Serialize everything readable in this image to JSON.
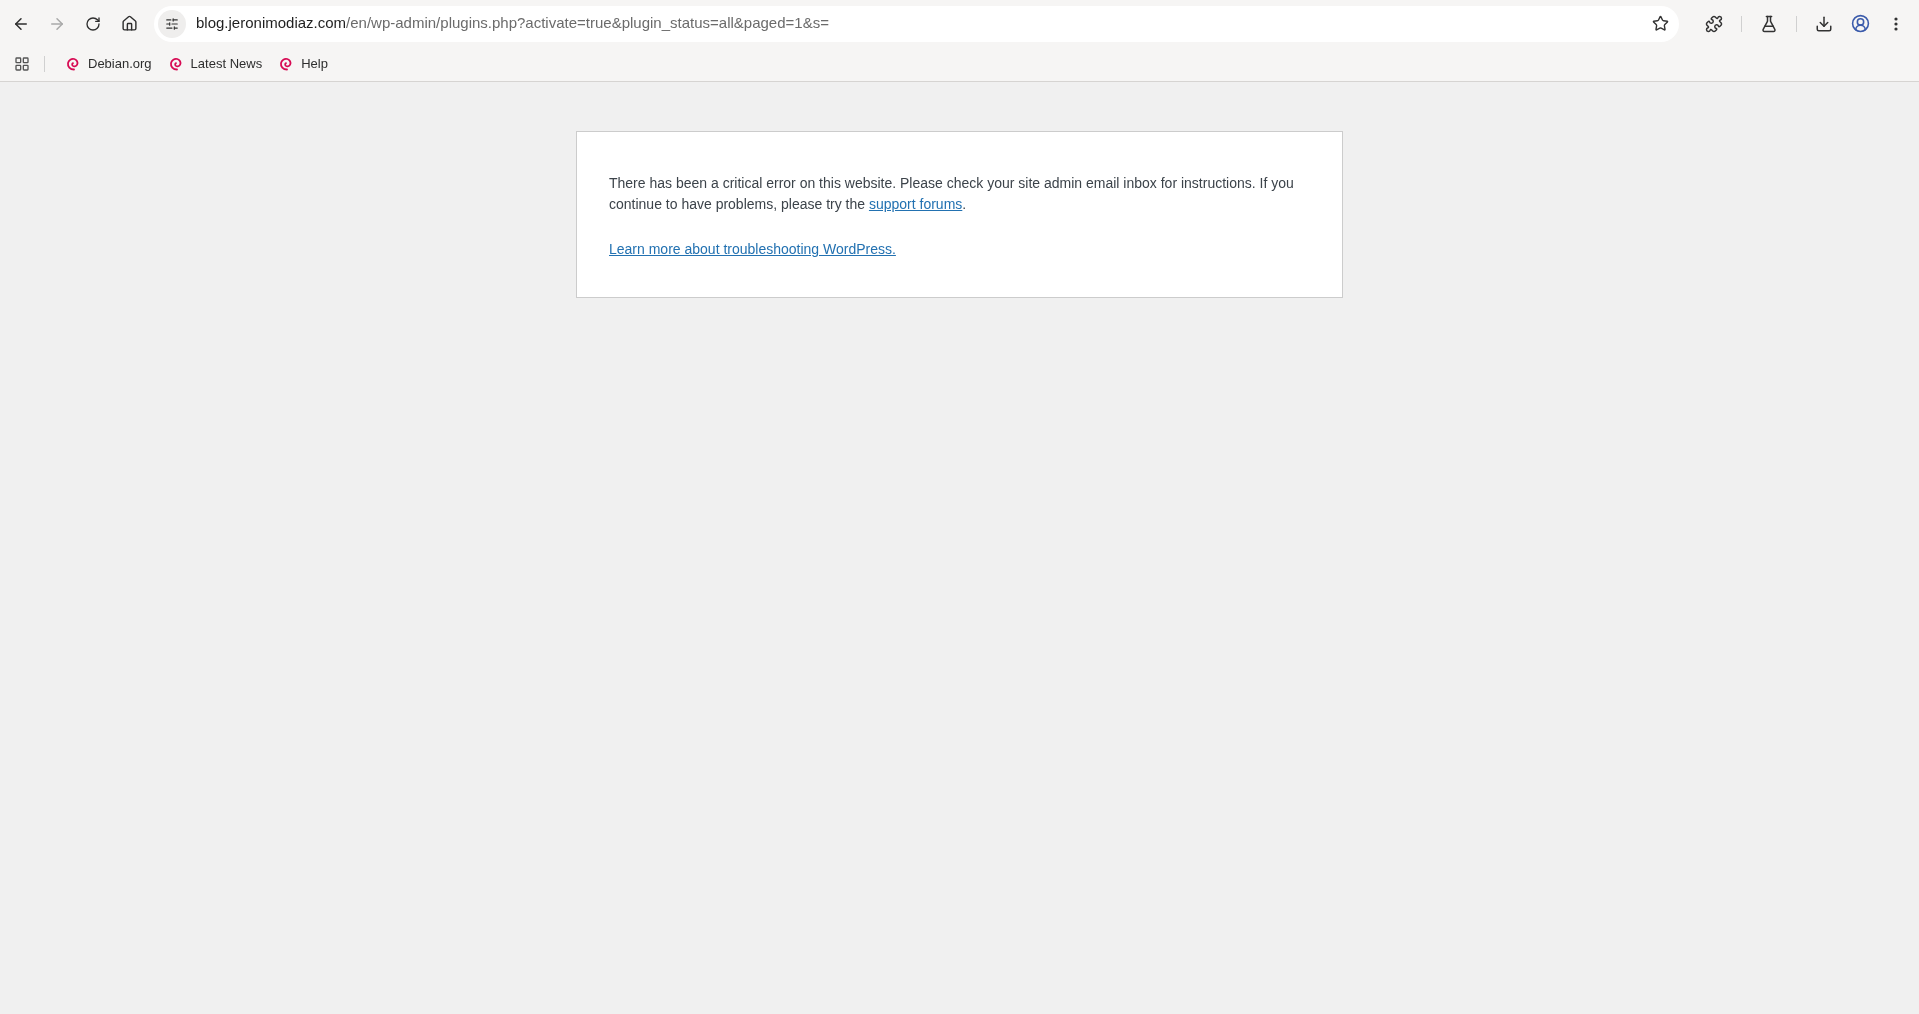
{
  "toolbar": {
    "forward": {
      "disabled": true
    }
  },
  "address_bar": {
    "host": "blog.jeronimodiaz.com",
    "path": "/en/wp-admin/plugins.php?activate=true&plugin_status=all&paged=1&s="
  },
  "bookmarks": [
    {
      "label": "Debian.org"
    },
    {
      "label": "Latest News"
    },
    {
      "label": "Help"
    }
  ],
  "error_card": {
    "message_before": "There has been a critical error on this website. Please check your site admin email inbox for instructions. If you continue to have problems, please try the ",
    "message_link": "support forums",
    "message_after": ".",
    "help_link": "Learn more about troubleshooting WordPress."
  }
}
